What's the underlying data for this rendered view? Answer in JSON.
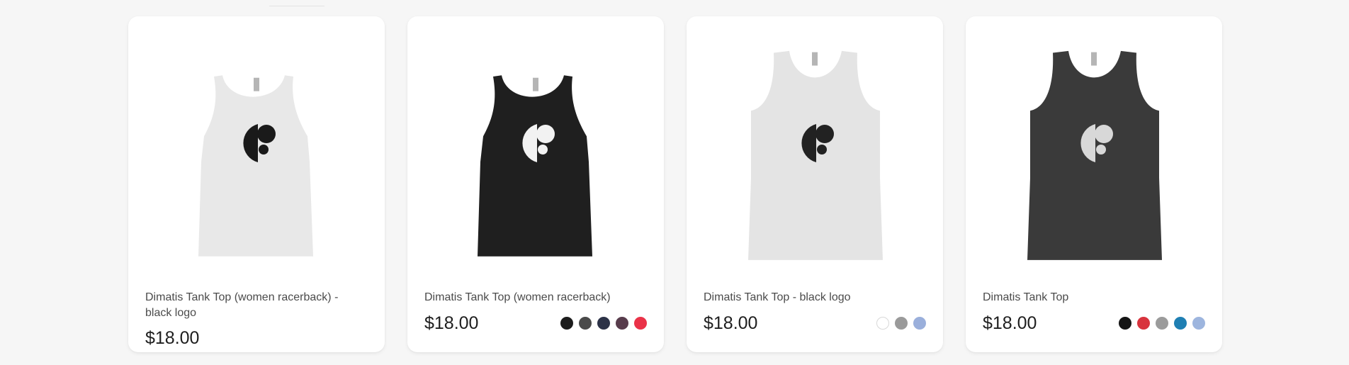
{
  "products": [
    {
      "image_alt": "tank-top-white-racerback",
      "title": "Dimatis Tank Top (women racerback) - black logo",
      "price": "$18.00",
      "style": "racerback",
      "shirt_color": "#e8e8e8",
      "logo_color": "#1a1a1a",
      "swatches": []
    },
    {
      "image_alt": "tank-top-black-racerback",
      "title": "Dimatis Tank Top (women racerback)",
      "price": "$18.00",
      "style": "racerback",
      "shirt_color": "#1f1f1f",
      "logo_color": "#f2f2f2",
      "swatches": [
        "#1c1c1c",
        "#4a4a4a",
        "#2c3247",
        "#583c4c",
        "#ea3248"
      ]
    },
    {
      "image_alt": "tank-top-white",
      "title": "Dimatis Tank Top - black logo",
      "price": "$18.00",
      "style": "classic",
      "shirt_color": "#e4e4e4",
      "logo_color": "#222222",
      "swatches": [
        "#ffffff",
        "#9a9a9a",
        "#9aafdb"
      ]
    },
    {
      "image_alt": "tank-top-charcoal",
      "title": "Dimatis Tank Top",
      "price": "$18.00",
      "style": "classic",
      "shirt_color": "#3a3a3a",
      "logo_color": "#d8d8d8",
      "swatches": [
        "#151515",
        "#d8333d",
        "#9b9b9b",
        "#1f7fb3",
        "#9db5de"
      ]
    }
  ]
}
